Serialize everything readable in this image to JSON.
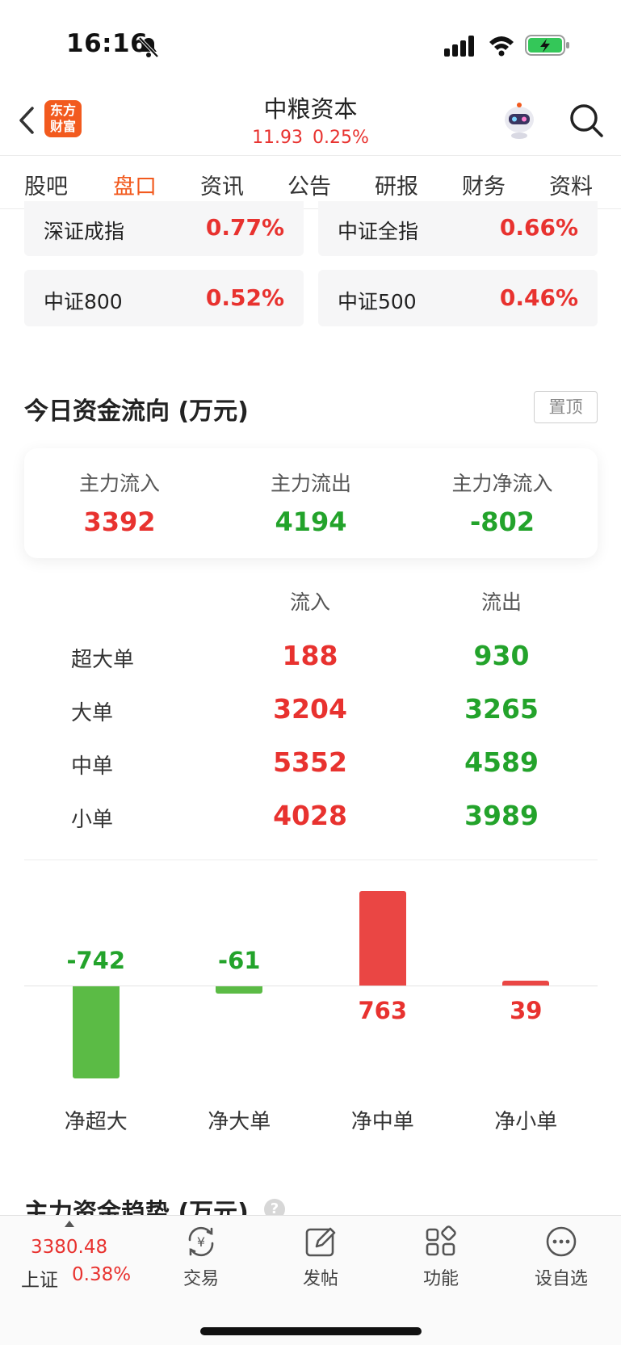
{
  "status_bar": {
    "time": "16:16"
  },
  "header": {
    "logo_line1": "东方",
    "logo_line2": "财富",
    "stock_name": "中粮资本",
    "price": "11.93",
    "change_pct": "0.25%"
  },
  "tabs": [
    {
      "label": "股吧"
    },
    {
      "label": "盘口"
    },
    {
      "label": "资讯"
    },
    {
      "label": "公告"
    },
    {
      "label": "研报"
    },
    {
      "label": "财务"
    },
    {
      "label": "资料"
    }
  ],
  "active_tab": "盘口",
  "indices": [
    {
      "name": "深证成指",
      "value": "0.77%"
    },
    {
      "name": "中证全指",
      "value": "0.66%"
    },
    {
      "name": "中证800",
      "value": "0.52%"
    },
    {
      "name": "中证500",
      "value": "0.46%"
    }
  ],
  "fund_flow": {
    "title": "今日资金流向 (万元)",
    "pin_label": "置顶",
    "summary": [
      {
        "label": "主力流入",
        "value": "3392"
      },
      {
        "label": "主力流出",
        "value": "4194"
      },
      {
        "label": "主力净流入",
        "value": "-802"
      }
    ],
    "table_headers": {
      "inflow": "流入",
      "outflow": "流出"
    },
    "rows": [
      {
        "label": "超大单",
        "inflow": "188",
        "outflow": "930"
      },
      {
        "label": "大单",
        "inflow": "3204",
        "outflow": "3265"
      },
      {
        "label": "中单",
        "inflow": "5352",
        "outflow": "4589"
      },
      {
        "label": "小单",
        "inflow": "4028",
        "outflow": "3989"
      }
    ]
  },
  "chart_data": {
    "type": "bar",
    "categories": [
      "净超大",
      "净大单",
      "净中单",
      "净小单"
    ],
    "values": [
      -742,
      -61,
      763,
      39
    ],
    "value_labels": [
      "-742",
      "-61",
      "763",
      "39"
    ],
    "colors": {
      "positive": "#ea4644",
      "negative": "#5bbb45"
    }
  },
  "trend": {
    "title": "主力资金趋势 (万元)",
    "help_icon": "?"
  },
  "bottom_nav": {
    "index_value": "3380.48",
    "index_name": "上证",
    "index_change": "0.38%",
    "items": [
      {
        "label": "交易",
        "icon": "yuan-refresh-icon"
      },
      {
        "label": "发帖",
        "icon": "edit-icon"
      },
      {
        "label": "功能",
        "icon": "grid-icon"
      },
      {
        "label": "设自选",
        "icon": "more-icon"
      }
    ]
  }
}
